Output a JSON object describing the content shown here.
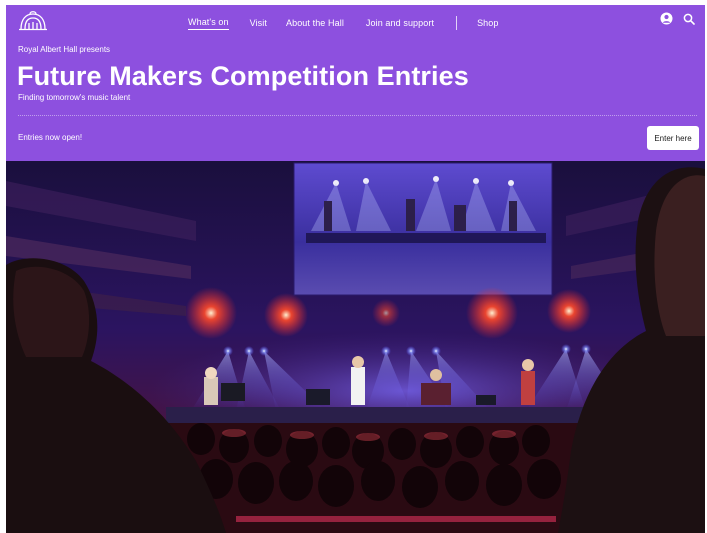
{
  "nav": {
    "logo_icon": "royal-albert-hall-dome-logo",
    "links": [
      {
        "label": "What's on",
        "active": true
      },
      {
        "label": "Visit",
        "active": false
      },
      {
        "label": "About the Hall",
        "active": false
      },
      {
        "label": "Join and support",
        "active": false
      },
      {
        "label": "Shop",
        "active": false
      }
    ],
    "icons": [
      "account-icon",
      "search-icon"
    ]
  },
  "hero": {
    "kicker": "Royal Albert Hall presents",
    "title": "Future Makers Competition Entries",
    "subtitle": "Finding tomorrow's music talent",
    "status": "Entries now open!",
    "cta_label": "Enter here"
  },
  "image": {
    "subject": "concert-stage-photo"
  },
  "colors": {
    "banner": "#8d50df",
    "text": "#ffffff",
    "button_bg": "#ffffff",
    "button_text": "#1c1c1c"
  }
}
